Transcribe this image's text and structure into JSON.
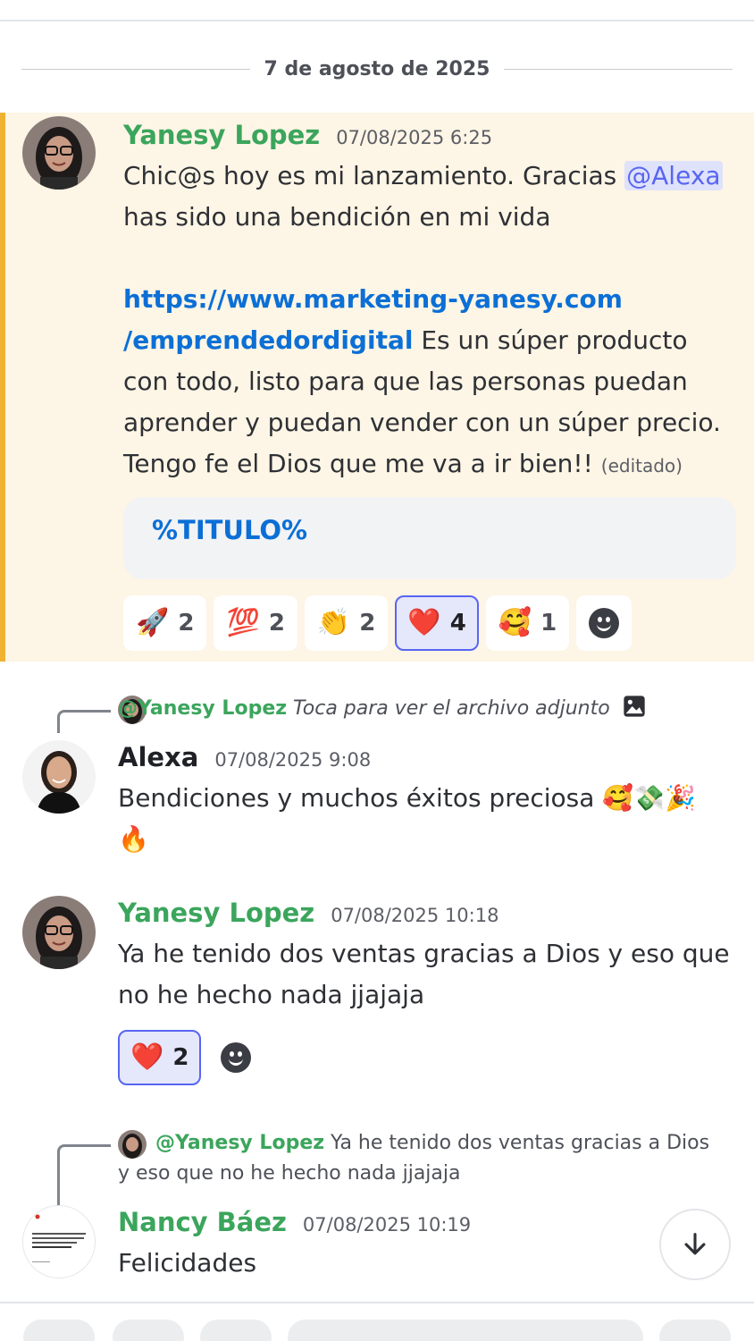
{
  "date_divider": "7 de agosto de 2025",
  "messages": [
    {
      "author": "Yanesy Lopez",
      "timestamp": "07/08/2025 6:25",
      "line1_pre": "Chic@s hoy es mi lanzamiento. Gracias ",
      "mention": "@Alexa",
      "line2": "has sido una bendición en mi vida",
      "link_part1": "https://www.marketing-yanesy.com",
      "link_part2": "/emprendedordigital",
      "text_after_link": " Es un súper producto con todo, listo para que las personas puedan aprender y puedan vender con un súper precio. Tengo fe el Dios que me va a ir bien!! ",
      "edited": "(editado)",
      "embed_title": "%TITULO%",
      "reactions": [
        {
          "emoji": "🚀",
          "count": "2"
        },
        {
          "emoji": "💯",
          "count": "2"
        },
        {
          "emoji": "👏",
          "count": "2"
        },
        {
          "emoji": "❤️",
          "count": "4"
        },
        {
          "emoji": "🥰",
          "count": "1"
        }
      ]
    },
    {
      "reply_to": "@Yanesy Lopez",
      "reply_preview": "Toca para ver el archivo adjunto",
      "author": "Alexa",
      "timestamp": "07/08/2025 9:08",
      "text": "Bendiciones y muchos éxitos preciosa 🥰💸🎉🔥"
    },
    {
      "author": "Yanesy Lopez",
      "timestamp": "07/08/2025 10:18",
      "text": "Ya he tenido dos ventas gracias a Dios y eso que no he hecho nada jjajaja",
      "reactions": [
        {
          "emoji": "❤️",
          "count": "2"
        }
      ]
    },
    {
      "reply_to": "@Yanesy Lopez",
      "reply_preview": "Ya he tenido dos ventas gracias a Dios y eso que no he hecho nada jjajaja",
      "author": "Nancy Báez",
      "timestamp": "07/08/2025 10:19",
      "text": "Felicidades"
    }
  ],
  "colors": {
    "highlight_bg": "#fdf5e5",
    "highlight_bar": "#f0b232",
    "author_green": "#3ba55c",
    "link_blue": "#0b6fd6",
    "mention_blue": "#5865f2"
  }
}
